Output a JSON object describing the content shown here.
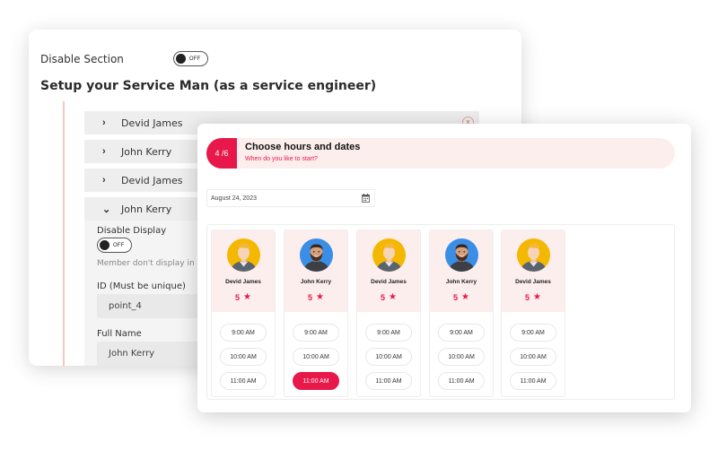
{
  "admin_panel": {
    "disable_section_label": "Disable Section",
    "disable_section_toggle": "OFF",
    "title": "Setup your Service Man (as a service engineer)",
    "items": [
      {
        "label": "Devid James"
      },
      {
        "label": "John Kerry"
      },
      {
        "label": "Devid James"
      },
      {
        "label": "John Kerry"
      }
    ],
    "close_icon": "x",
    "expanded": {
      "disable_display_label": "Disable Display",
      "disable_display_toggle": "OFF",
      "help_text": "Member don't display in th",
      "id_label": "ID (Must be unique)",
      "id_value": "point_4",
      "full_name_label": "Full Name",
      "full_name_value": "John Kerry"
    }
  },
  "booking": {
    "step": "4 /6",
    "title": "Choose hours and dates",
    "subtitle": "When do you like to start?",
    "date_value": "August 24, 2023",
    "date_icon": "calendar-icon",
    "accent_color": "#e8194a",
    "staff": [
      {
        "name": "Devid James",
        "rating": "5",
        "avatar": "blond-man-yellow",
        "slots": [
          "9:00 AM",
          "10:00 AM",
          "11:00 AM"
        ],
        "selected": -1
      },
      {
        "name": "John Kerry",
        "rating": "5",
        "avatar": "bearded-man-blue",
        "slots": [
          "9:00 AM",
          "10:00 AM",
          "11:00 AM"
        ],
        "selected": 2
      },
      {
        "name": "Devid James",
        "rating": "5",
        "avatar": "blond-man-yellow",
        "slots": [
          "9:00 AM",
          "10:00 AM",
          "11:00 AM"
        ],
        "selected": -1
      },
      {
        "name": "John Kerry",
        "rating": "5",
        "avatar": "bearded-man-blue",
        "slots": [
          "9:00 AM",
          "10:00 AM",
          "11:00 AM"
        ],
        "selected": -1
      },
      {
        "name": "Devid James",
        "rating": "5",
        "avatar": "blond-man-yellow",
        "slots": [
          "9:00 AM",
          "10:00 AM",
          "11:00 AM"
        ],
        "selected": -1
      }
    ]
  }
}
